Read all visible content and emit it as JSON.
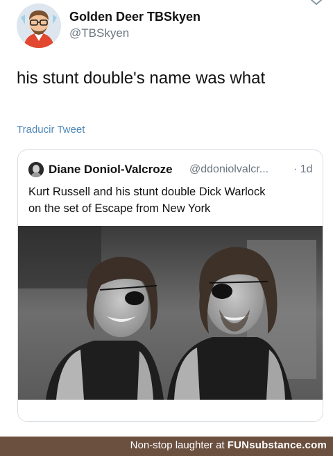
{
  "author": {
    "name": "Golden Deer TBSkyen",
    "handle": "@TBSkyen"
  },
  "tweet": {
    "text": "his stunt double's name was what",
    "translate_label": "Traducir Tweet"
  },
  "quoted": {
    "name": "Diane Doniol-Valcroze",
    "handle": "@ddoniolvalcr...",
    "time": "· 1d",
    "text_line1": "Kurt Russell and his stunt double Dick Warlock",
    "text_line2": "on the set of Escape from New York"
  },
  "footer": {
    "prefix": "Non-stop laughter at ",
    "brand": "FUNsubstance.com"
  },
  "icons": {
    "menu": "chevron-down-icon"
  }
}
